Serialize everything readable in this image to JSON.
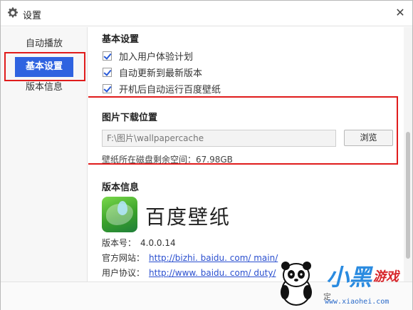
{
  "window": {
    "title": "设置",
    "title_icon": "gear-icon",
    "close_icon": "close-icon"
  },
  "sidebar": {
    "items": [
      {
        "label": "自动播放"
      },
      {
        "label": "基本设置",
        "selected": true
      },
      {
        "label": "版本信息"
      }
    ]
  },
  "basic_settings": {
    "title": "基本设置",
    "checkboxes": [
      {
        "label": "加入用户体验计划",
        "checked": true
      },
      {
        "label": "自动更新到最新版本",
        "checked": true
      },
      {
        "label": "开机后自动运行百度壁纸",
        "checked": true
      }
    ]
  },
  "download": {
    "title": "图片下载位置",
    "path_value": "F:\\图片\\wallpapercache",
    "browse_label": "浏览",
    "disk_info": "壁纸所在磁盘剩余空间：67.98GB"
  },
  "version_info": {
    "title": "版本信息",
    "app_name": "百度壁纸",
    "version_label": "版本号：",
    "version_value": "4.0.0.14",
    "website_label": "官方网站：",
    "website_url": "http://bizhi. baidu. com/ main/",
    "agreement_label": "用户协议：",
    "agreement_url": "http://www. baidu. com/ duty/"
  },
  "watermark": {
    "brand_text": "小黑",
    "brand_text2": "游戏",
    "url": "www.xiaohei.com",
    "fragment": "定"
  },
  "colors": {
    "accent": "#2f63e0",
    "highlight_border": "#e01c1c",
    "link": "#2a4fcf"
  }
}
